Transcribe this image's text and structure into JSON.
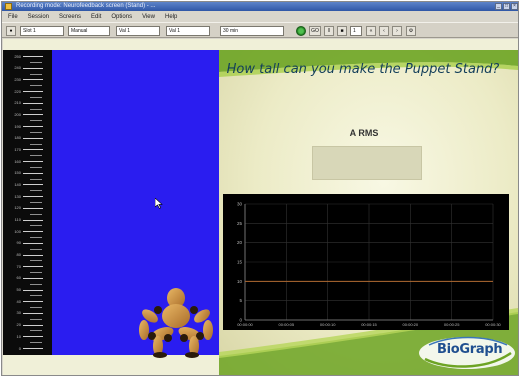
{
  "window": {
    "title": "Recording mode: Neurofeedback screen (Stand) - ..."
  },
  "menubar": {
    "items": [
      "File",
      "Session",
      "Screens",
      "Edit",
      "Options",
      "View",
      "Help"
    ]
  },
  "toolbar": {
    "slot_label": "Slot 1",
    "mode_label": "Manual",
    "view_label": "Val 1",
    "scale_label": "Val 1",
    "time_label": "30 min",
    "go_label": "GO",
    "page_label": "1"
  },
  "scale": {
    "tick_labels": [
      "250",
      "240",
      "230",
      "220",
      "210",
      "200",
      "190",
      "180",
      "170",
      "160",
      "150",
      "140",
      "130",
      "120",
      "110",
      "100",
      "90",
      "80",
      "70",
      "60",
      "50",
      "40",
      "30",
      "20",
      "10",
      "0"
    ]
  },
  "question": {
    "text": "How tall can you make the Puppet Stand?"
  },
  "rms": {
    "label": "A RMS"
  },
  "chart_data": {
    "type": "line",
    "ylim": [
      0,
      30
    ],
    "y_ticks": [
      "30",
      "25",
      "20",
      "15",
      "10",
      "5",
      "0"
    ],
    "x_ticks": [
      "00:00:00",
      "00:00:05",
      "00:00:10",
      "00:00:15",
      "00:00:20",
      "00:00:25",
      "00:00:30"
    ],
    "grid": true,
    "series": [
      {
        "values": [
          10,
          10,
          10,
          10,
          10,
          10,
          10
        ],
        "color": "#b06a30"
      }
    ]
  },
  "logo": {
    "text": "BioGraph"
  },
  "colors": {
    "stage": "#2a1df0",
    "panel": "#ecebc6",
    "accent_green": "#7cb02a",
    "question_text": "#123e5a",
    "logo_text": "#1f4f8f"
  }
}
